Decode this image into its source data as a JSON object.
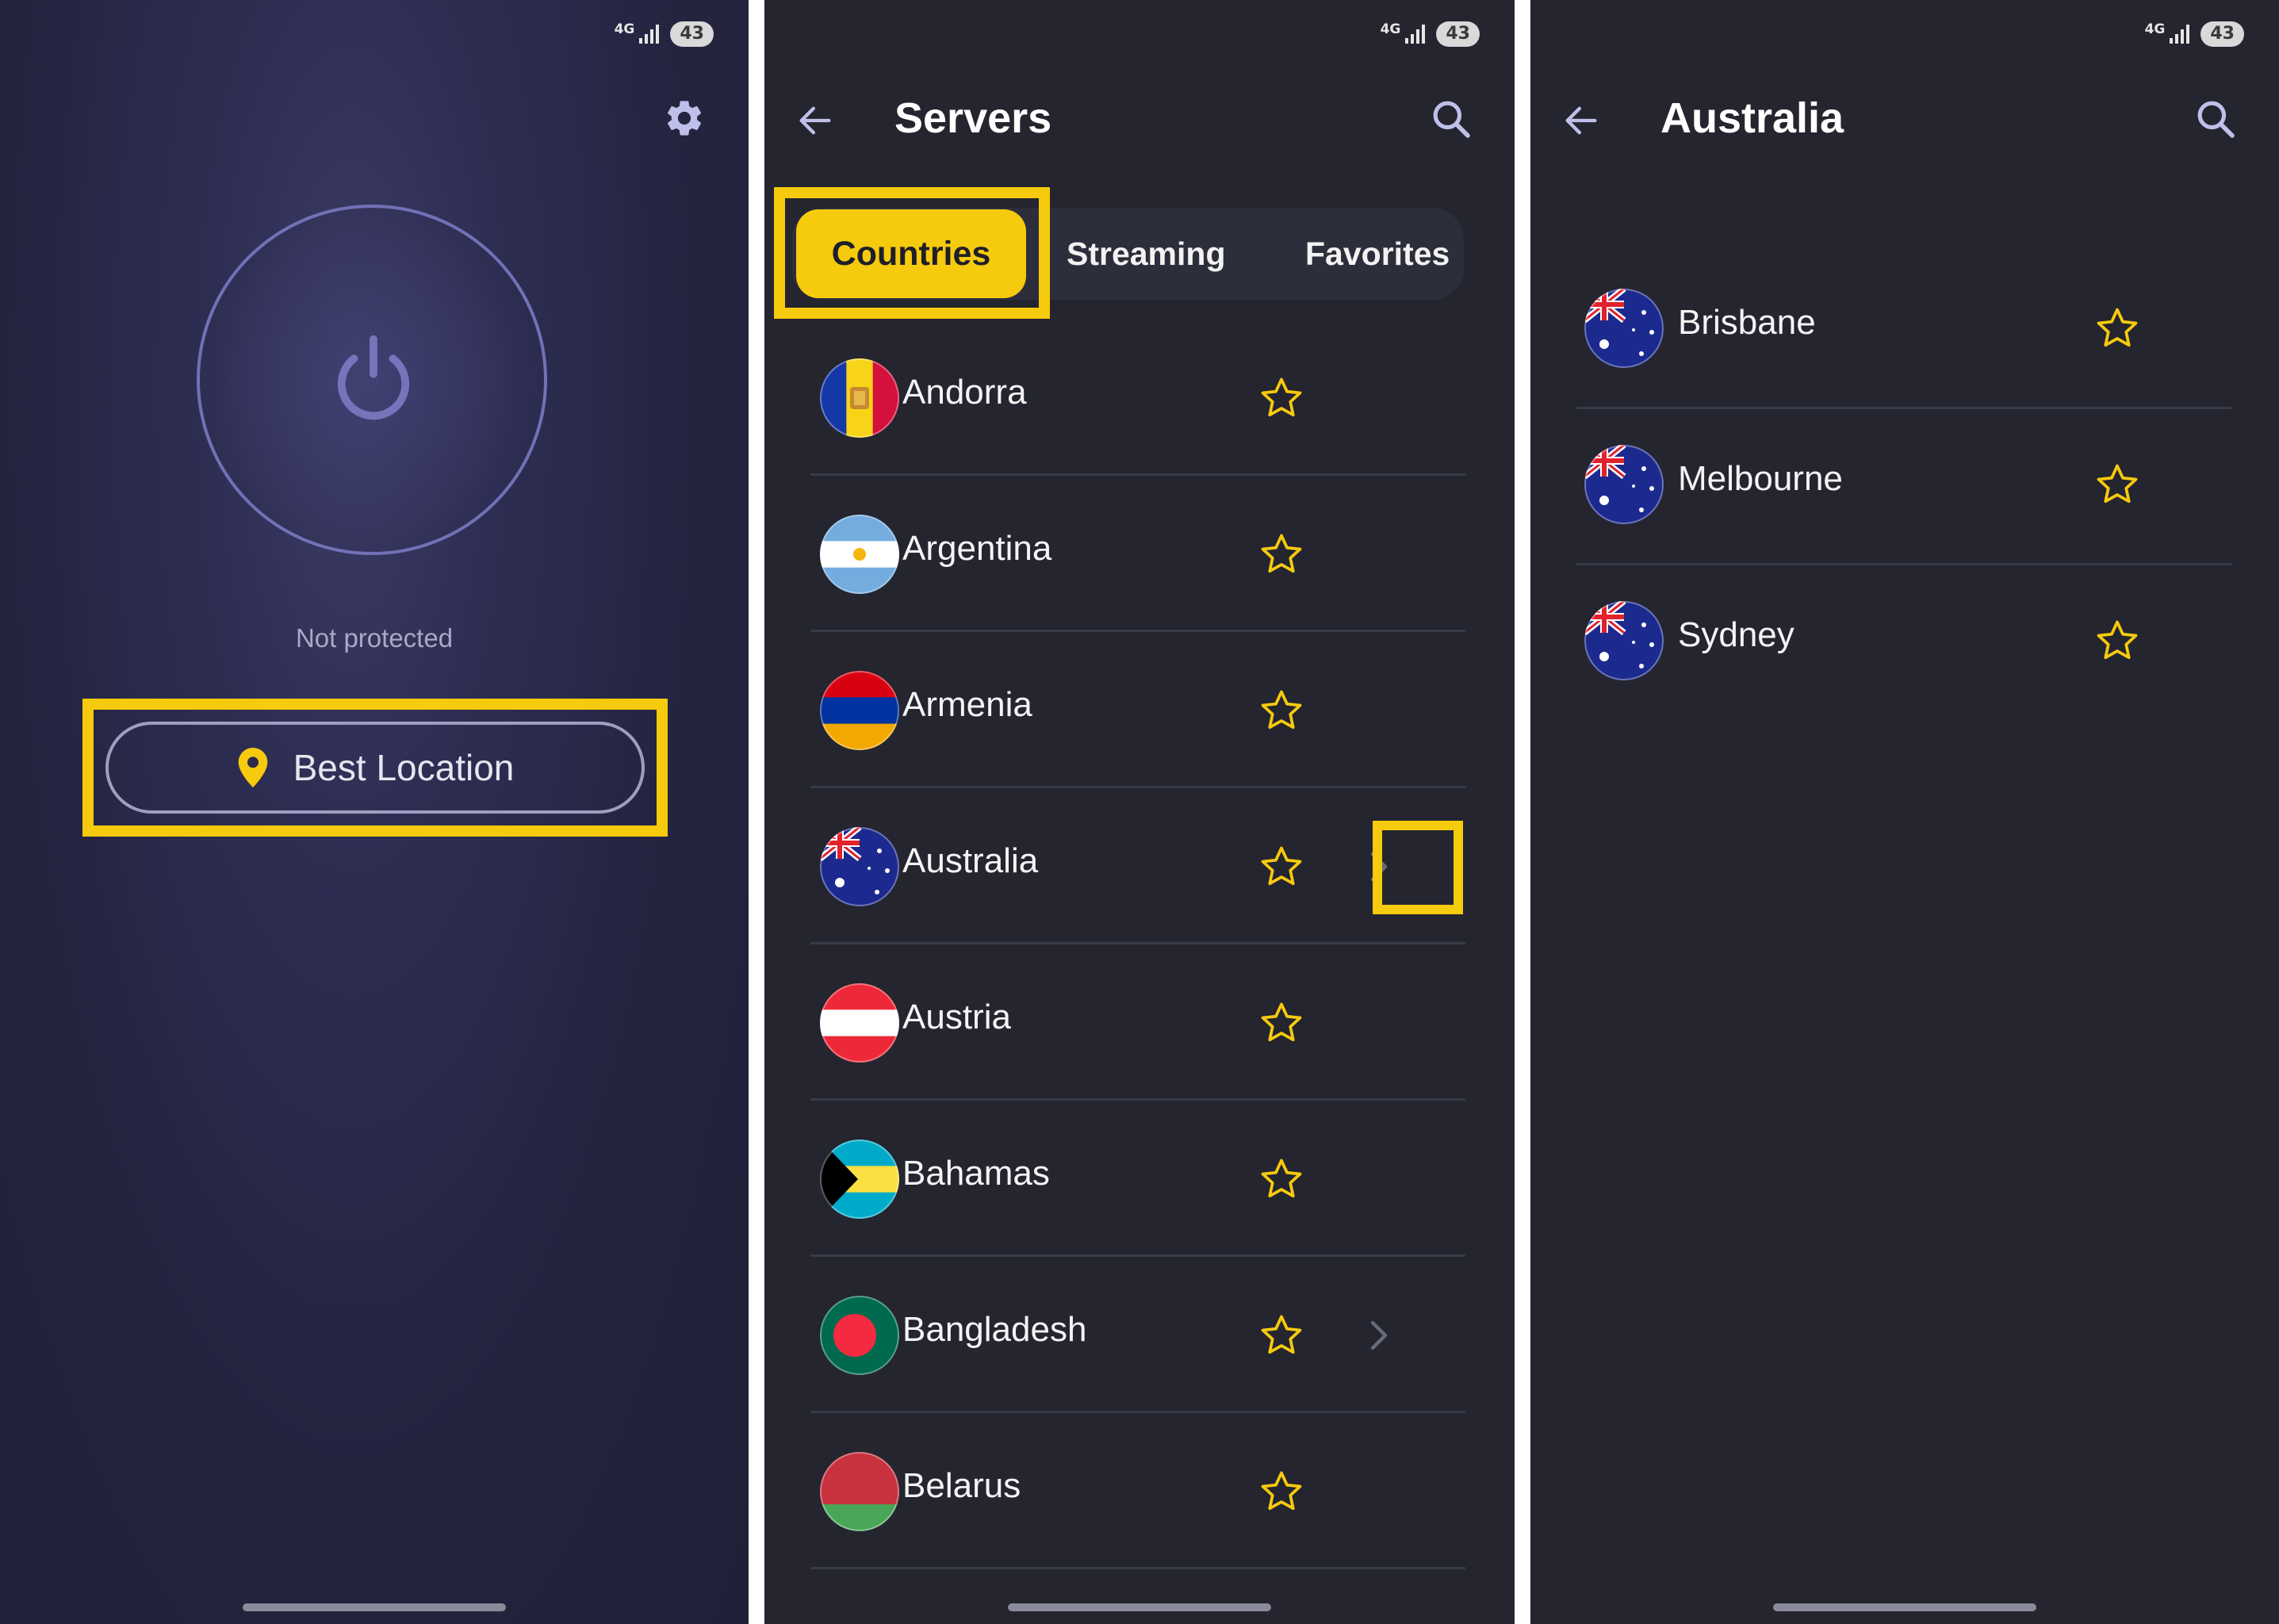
{
  "status_bar": {
    "network": "4G",
    "battery": "43"
  },
  "home": {
    "status_text": "Not protected",
    "location_button": "Best Location"
  },
  "servers": {
    "title": "Servers",
    "tabs": {
      "countries": "Countries",
      "streaming": "Streaming",
      "favorites": "Favorites"
    },
    "countries": [
      {
        "name": "Andorra",
        "has_sub": false
      },
      {
        "name": "Argentina",
        "has_sub": false
      },
      {
        "name": "Armenia",
        "has_sub": false
      },
      {
        "name": "Australia",
        "has_sub": true
      },
      {
        "name": "Austria",
        "has_sub": false
      },
      {
        "name": "Bahamas",
        "has_sub": false
      },
      {
        "name": "Bangladesh",
        "has_sub": true
      },
      {
        "name": "Belarus",
        "has_sub": false
      }
    ]
  },
  "australia": {
    "title": "Australia",
    "cities": [
      {
        "name": "Brisbane"
      },
      {
        "name": "Melbourne"
      },
      {
        "name": "Sydney"
      }
    ]
  },
  "colors": {
    "accent": "#f6ca0d",
    "panel_bg": "#24252f",
    "ring": "#7271b7"
  }
}
